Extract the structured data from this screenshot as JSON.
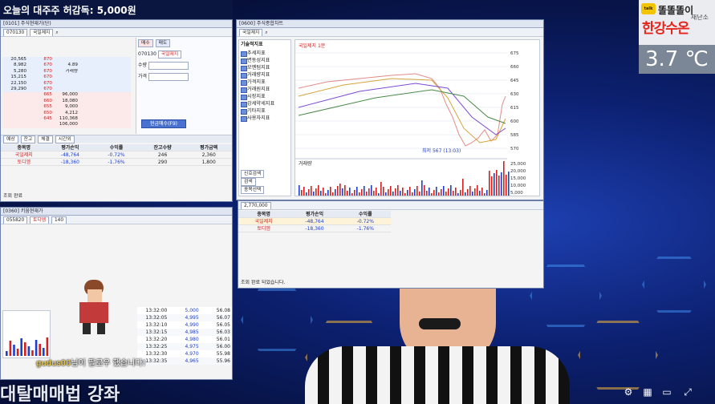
{
  "headline": "오늘의 대주주 허감독: 5,000원",
  "left_win": {
    "title": "[0101] 주식현재가(단)",
    "code": "070130",
    "stock": "국일제지",
    "book": [
      [
        "20,565",
        "870",
        "",
        "",
        ""
      ],
      [
        "8,982",
        "670",
        "4.89",
        "",
        ""
      ],
      [
        "5,280",
        "670",
        "거래량",
        "",
        ""
      ],
      [
        "15,215",
        "670",
        "",
        "",
        ""
      ],
      [
        "22,150",
        "670",
        "",
        "",
        ""
      ],
      [
        "29,290",
        "670",
        "",
        "",
        ""
      ],
      [
        "",
        "665",
        "96,000",
        "",
        ""
      ],
      [
        "",
        "660",
        "18,080",
        "",
        ""
      ],
      [
        "",
        "655",
        "9,000",
        "",
        ""
      ],
      [
        "",
        "650",
        "4,212",
        "",
        ""
      ],
      [
        "",
        "645",
        "110,368",
        "",
        ""
      ],
      [
        "",
        "",
        "106,000",
        "",
        ""
      ]
    ],
    "tabs": [
      "예상",
      "잔고",
      "체결",
      "시간외"
    ],
    "buy_label": "매수",
    "sell_label": "매도",
    "qty_label": "수량",
    "price_label": "가격",
    "order_button": "현금매수(F9)",
    "holdings_head": [
      "종목명",
      "평가손익",
      "수익률",
      "잔고수량",
      "평가금액"
    ],
    "holdings": [
      [
        "국일제지",
        "-48,764",
        "-0.72%",
        "246",
        "2,360"
      ],
      [
        "토디엠",
        "-18,360",
        "-1.76%",
        "290",
        "1,800"
      ]
    ],
    "status": "조회 완료"
  },
  "chart_win": {
    "title": "[0600] 주식종합차트",
    "stock": "국일제지",
    "tree": [
      "추세지표",
      "변동성지표",
      "모멘텀지표",
      "거래량지표",
      "가격지표",
      "거래원지표",
      "시장지표",
      "강세약세지표",
      "기타지표",
      "사용자지표"
    ],
    "tree_head": "기술적지표",
    "chart_label": "국일제지 1분",
    "low_label": "최저 567 (13:03)",
    "volume_label": "거래량",
    "price_ticks": [
      "675",
      "660",
      "645",
      "630",
      "615",
      "600",
      "585",
      "570"
    ],
    "vol_ticks": [
      "25,000",
      "20,000",
      "15,000",
      "10,000",
      "5,000"
    ],
    "side_buttons": [
      "신호검색",
      "검색",
      "종목선택"
    ],
    "holdings_head": [
      "종목명",
      "평가손익",
      "수익률"
    ],
    "holdings": [
      [
        "국일제지",
        "-48,764",
        "-0.72%"
      ],
      [
        "토디엠",
        "-18,360",
        "-1.76%"
      ]
    ],
    "balance": "2,770,000",
    "status": "조회 완료 되었습니다."
  },
  "lower_win": {
    "title": "[0360] 키움현재가",
    "code": "055820",
    "stock": "토디엠",
    "price": "140",
    "times": [
      "13:32:00",
      "13:32:05",
      "13:32:10",
      "13:32:15",
      "13:32:20",
      "13:32:25",
      "13:32:30",
      "13:32:35"
    ],
    "prices": [
      "5,000",
      "4,995",
      "4,990",
      "4,985",
      "4,980",
      "4,975",
      "4,970",
      "4,965"
    ],
    "volumes": [
      "56.08",
      "56.07",
      "56.05",
      "56.03",
      "56.01",
      "56.00",
      "55.98",
      "55.96"
    ]
  },
  "overlay": {
    "brand": "똘똘똘이",
    "brand_sub": "재난소",
    "city": "한강수온",
    "temp": "3.7 ℃"
  },
  "chat": {
    "user": "gudus00",
    "message": "님이 팔로우 했습니다!"
  },
  "caption": "대탈매매법 강좌",
  "colors": {
    "accent": "#d21f1f",
    "down": "#1c3fd0",
    "bg": "#0a1a4a"
  }
}
